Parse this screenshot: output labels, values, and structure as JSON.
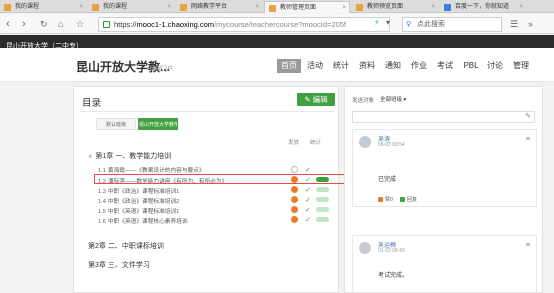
{
  "browser": {
    "tabs": [
      {
        "label": "我的课程"
      },
      {
        "label": "我的课程"
      },
      {
        "label": "网络教学平台"
      },
      {
        "label": "教师管理页面"
      },
      {
        "label": "教师预览页面"
      },
      {
        "label": "百度一下，你就知道"
      }
    ],
    "url_scheme": "https://",
    "url_host": "mooc1-1.chaoxing.com",
    "url_path": "/mycourse/teachercourse?moocId=205f",
    "search_placeholder": "点此搜索"
  },
  "school": {
    "name": "昆山开放大学（二中专）"
  },
  "course": {
    "title": "昆山开放大学教...",
    "portal": "课程门户",
    "nav": [
      "首页",
      "活动",
      "统计",
      "资料",
      "通知",
      "作业",
      "考试",
      "PBL",
      "讨论",
      "管理"
    ],
    "active_nav": "首页"
  },
  "catalog": {
    "title": "目录",
    "edit_label": "编辑",
    "subtabs": [
      "默认班级",
      "昆山开放大学教学"
    ],
    "col_publish": "发放",
    "col_stats": "统计",
    "chapters": [
      {
        "label": "第1章 一、教学能力培训",
        "expand": "∧"
      },
      {
        "label": "第2章 二、中职课标培训"
      },
      {
        "label": "第3章 三、文件学习"
      }
    ],
    "sections": [
      {
        "num": "1.1",
        "label": "黄海霞——《教案设计的内容与要点》"
      },
      {
        "num": "1.2",
        "label": "潘际萍——数学能力讲座《有所为、有所必为》"
      },
      {
        "num": "1.3",
        "label": "中职《政治》课程标准培训1"
      },
      {
        "num": "1.4",
        "label": "中职《政治》课程标准培训2"
      },
      {
        "num": "1.5",
        "label": "中职《英语》课程标准培训1"
      },
      {
        "num": "1.6",
        "label": "中职《英语》课程核心素养培训"
      }
    ]
  },
  "discussion": {
    "send_label": "发送对象",
    "send_value": "全部班级",
    "posts": [
      {
        "name": "吴涛",
        "time": "06-03 09:54",
        "body": "已完成",
        "like": "赞0",
        "reply": "回复"
      },
      {
        "name": "吴运梅",
        "time": "01-03 08:43",
        "body": "考试完成。"
      }
    ]
  }
}
